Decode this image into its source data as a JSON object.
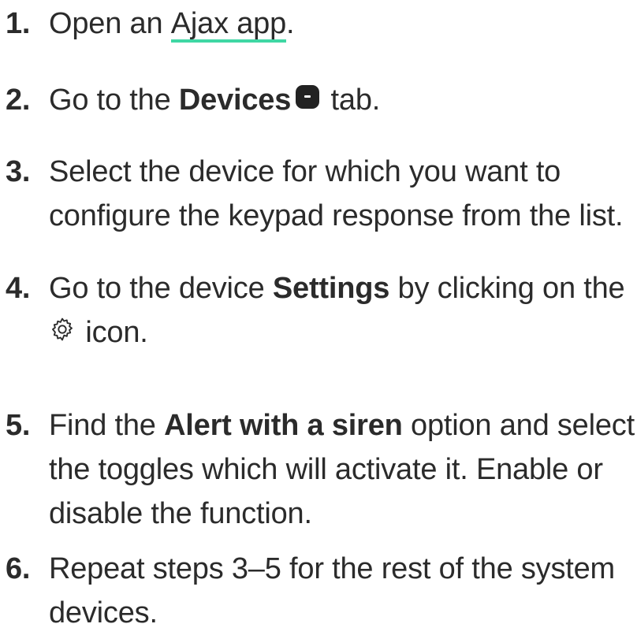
{
  "steps": [
    {
      "num": "1.",
      "pre": "Open an ",
      "link": "Ajax app",
      "post": "."
    },
    {
      "num": "2.",
      "pre": "Go to the ",
      "bold": "Devices",
      "icon": "devices-tab-icon",
      "post": " tab."
    },
    {
      "num": "3.",
      "line1": "Select the device for which you want to",
      "line2": "configure the keypad response from the list."
    },
    {
      "num": "4.",
      "pre": "Go to the device ",
      "bold": "Settings",
      "post": " by clicking on the",
      "icon": "gear-icon",
      "line2": " icon."
    },
    {
      "num": "5.",
      "pre": "Find the ",
      "bold": "Alert with a siren",
      "post": " option and select",
      "line2": "the toggles which will activate it. Enable or",
      "line3": "disable the function."
    },
    {
      "num": "6.",
      "line1": "Repeat steps 3–5 for the rest of the system",
      "line2": "devices."
    }
  ],
  "colors": {
    "text": "#2b2b2b",
    "link_underline": "#3fd7a4",
    "icon_fill": "#222222"
  }
}
